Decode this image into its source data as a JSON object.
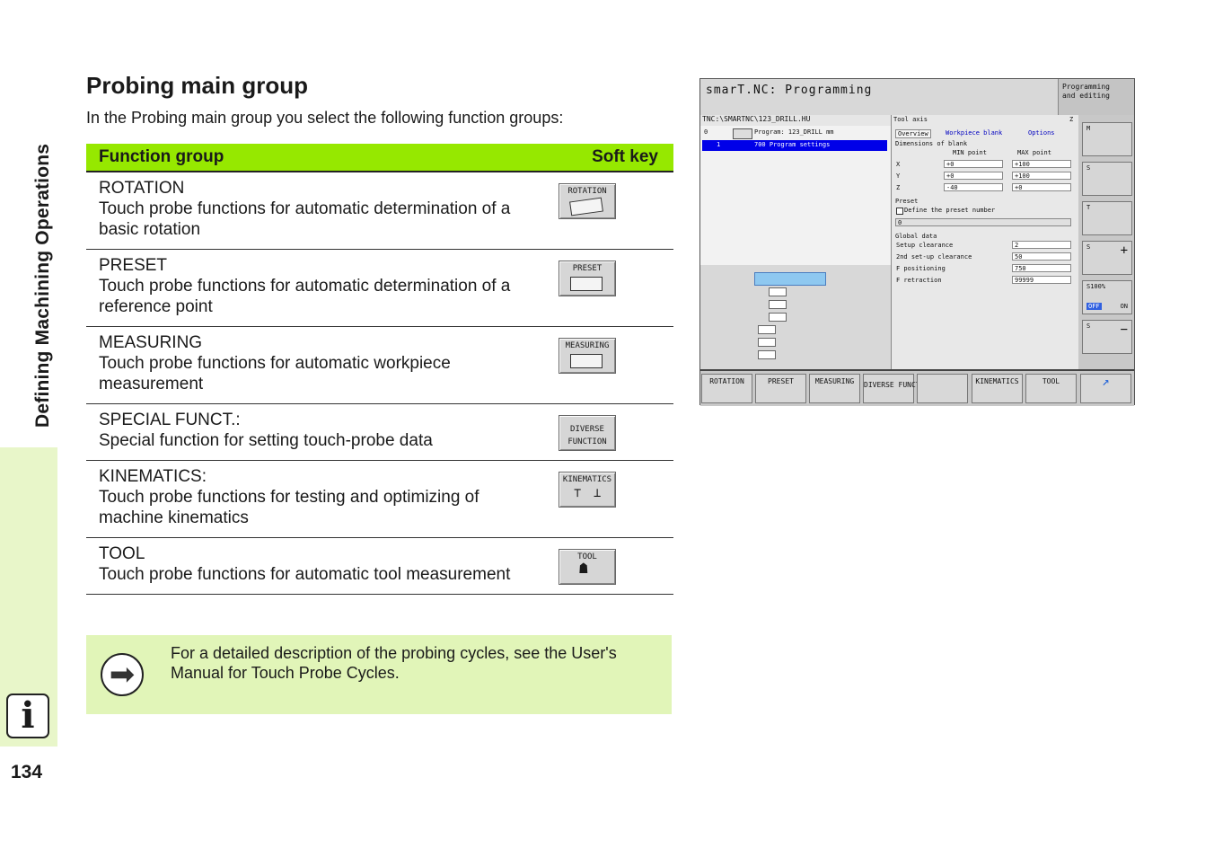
{
  "sidebar": {
    "title": "Defining Machining Operations",
    "page_number": "134",
    "info_icon": "i"
  },
  "heading": "Probing main group",
  "intro": "In the Probing main group you select the following function groups:",
  "table": {
    "col_function": "Function group",
    "col_softkey": "Soft key",
    "rows": [
      {
        "name": "ROTATION",
        "desc": "Touch probe functions for automatic determination of a basic rotation",
        "key": "ROTATION"
      },
      {
        "name": "PRESET",
        "desc": "Touch probe functions for automatic determination of a reference point",
        "key": "PRESET"
      },
      {
        "name": "MEASURING",
        "desc": "Touch probe functions for automatic workpiece measurement",
        "key": "MEASURING"
      },
      {
        "name": "SPECIAL FUNCT.:",
        "desc": "Special function for setting touch-probe data",
        "key": "DIVERSE FUNCTION"
      },
      {
        "name": "KINEMATICS:",
        "desc": "Touch probe functions for testing and optimizing of machine kinematics",
        "key": "KINEMATICS"
      },
      {
        "name": "TOOL",
        "desc": "Touch probe functions for automatic tool measurement",
        "key": "TOOL"
      }
    ]
  },
  "note": "For a detailed description of the probing cycles, see the User's Manual for Touch Probe Cycles.",
  "screen": {
    "title": "smarT.NC: Programming",
    "mode_line1": "Programming",
    "mode_line2": "and editing",
    "path": "TNC:\\SMARTNC\\123_DRILL.HU",
    "tree_row0": "Program: 123_DRILL mm",
    "tree_row1": "700 Program settings",
    "tree_idx0": "0",
    "tree_idx1": "1",
    "tool_axis_label": "Tool axis",
    "tool_axis_value": "Z",
    "tabs": [
      "Overview",
      "Workpiece blank",
      "Options"
    ],
    "blank_title": "Dimensions of blank",
    "min_label": "MIN point",
    "max_label": "MAX point",
    "axes": [
      "X",
      "Y",
      "Z"
    ],
    "min_values": [
      "+0",
      "+0",
      "-40"
    ],
    "max_values": [
      "+100",
      "+100",
      "+0"
    ],
    "preset_title": "Preset",
    "preset_check": "Define the preset number",
    "preset_value": "0",
    "global_title": "Global data",
    "global_labels": [
      "Setup clearance",
      "2nd set-up clearance",
      "F positioning",
      "F retraction"
    ],
    "global_values": [
      "2",
      "50",
      "750",
      "99999"
    ],
    "side_keys": [
      "M",
      "S",
      "T",
      "S",
      "S100%",
      "S"
    ],
    "side_off": "OFF",
    "side_on": "ON",
    "softkeys": [
      "ROTATION",
      "PRESET",
      "MEASURING",
      "DIVERSE FUNCTION",
      "",
      "KINEMATICS",
      "TOOL",
      ""
    ]
  }
}
